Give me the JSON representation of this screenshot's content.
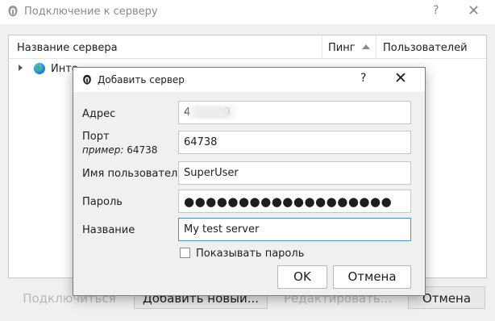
{
  "main_window": {
    "title": "Подключение к серверу",
    "help_symbol": "?",
    "close_symbol": "✕",
    "columns": {
      "name": "Название сервера",
      "ping": "Пинг",
      "users": "Пользователей"
    },
    "tree_items": [
      {
        "label": "Инте"
      }
    ],
    "buttons": {
      "connect": "Подключиться",
      "add_new": "Добавить новый...",
      "edit": "Редактировать...",
      "cancel": "Отмена"
    }
  },
  "dialog": {
    "title": "Добавить сервер",
    "help_symbol": "?",
    "close_symbol": "✕",
    "labels": {
      "address": "Адрес",
      "port": "Порт",
      "port_example_prefix": "пример:",
      "port_example_value": "64738",
      "username": "Имя пользователя",
      "password": "Пароль",
      "name": "Название",
      "show_password": "Показывать пароль"
    },
    "values": {
      "address": "4          9",
      "port": "64738",
      "username": "SuperUser",
      "password": "●●●●●●●●●●●●●●●●●●●",
      "name": "My test server"
    },
    "show_password_checked": false,
    "buttons": {
      "ok": "OK",
      "cancel": "Отмена"
    }
  },
  "colors": {
    "window_bg": "#f0f0f0",
    "focus_border": "#4a8fcc",
    "disabled_text": "#b8b8b8"
  },
  "icons": {
    "app": "mumble-icon",
    "server": "globe-icon"
  }
}
